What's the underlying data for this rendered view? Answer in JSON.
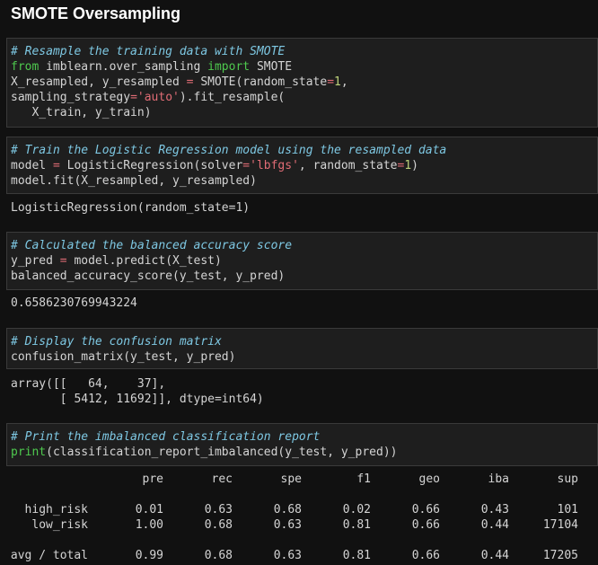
{
  "title": "SMOTE Oversampling",
  "cell1": {
    "l1": "# Resample the training data with SMOTE",
    "l2_from": "from",
    "l2_mod": " imblearn.over_sampling ",
    "l2_import": "import",
    "l2_name": " SMOTE",
    "l3_a": "X_resampled, y_resampled ",
    "l3_eq": "=",
    "l3_b": " SMOTE(random_state",
    "l3_eq2": "=",
    "l3_n": "1",
    "l3_c": ",",
    "l4_a": "sampling_strategy",
    "l4_eq": "=",
    "l4_s": "'auto'",
    "l4_b": ").fit_resample(",
    "l5": "   X_train, y_train)"
  },
  "cell2": {
    "l1": "# Train the Logistic Regression model using the resampled data",
    "l2_a": "model ",
    "l2_eq": "=",
    "l2_b": " LogisticRegression(solver",
    "l2_eq2": "=",
    "l2_s": "'lbfgs'",
    "l2_c": ", random_state",
    "l2_eq3": "=",
    "l2_n": "1",
    "l2_d": ")",
    "l3": "model.fit(X_resampled, y_resampled)"
  },
  "out2": "LogisticRegression(random_state=1)",
  "cell3": {
    "l1": "# Calculated the balanced accuracy score",
    "l2_a": "y_pred ",
    "l2_eq": "=",
    "l2_b": " model.predict(X_test)",
    "l3": "balanced_accuracy_score(y_test, y_pred)"
  },
  "out3": "0.6586230769943224",
  "cell4": {
    "l1": "# Display the confusion matrix",
    "l2": "confusion_matrix(y_test, y_pred)"
  },
  "out4": {
    "l1": "array([[   64,    37],",
    "l2": "       [ 5412, 11692]], dtype=int64)"
  },
  "cell5": {
    "l1": "# Print the imbalanced classification report",
    "l2_kw": "print",
    "l2_b": "(classification_report_imbalanced(y_test, y_pred))"
  },
  "report": {
    "headers": [
      "pre",
      "rec",
      "spe",
      "f1",
      "geo",
      "iba",
      "sup"
    ],
    "rows": [
      {
        "label": "high_risk",
        "values": [
          "0.01",
          "0.63",
          "0.68",
          "0.02",
          "0.66",
          "0.43",
          "101"
        ]
      },
      {
        "label": "low_risk",
        "values": [
          "1.00",
          "0.68",
          "0.63",
          "0.81",
          "0.66",
          "0.44",
          "17104"
        ]
      },
      {
        "label": "avg / total",
        "values": [
          "0.99",
          "0.68",
          "0.63",
          "0.81",
          "0.66",
          "0.44",
          "17205"
        ]
      }
    ]
  }
}
